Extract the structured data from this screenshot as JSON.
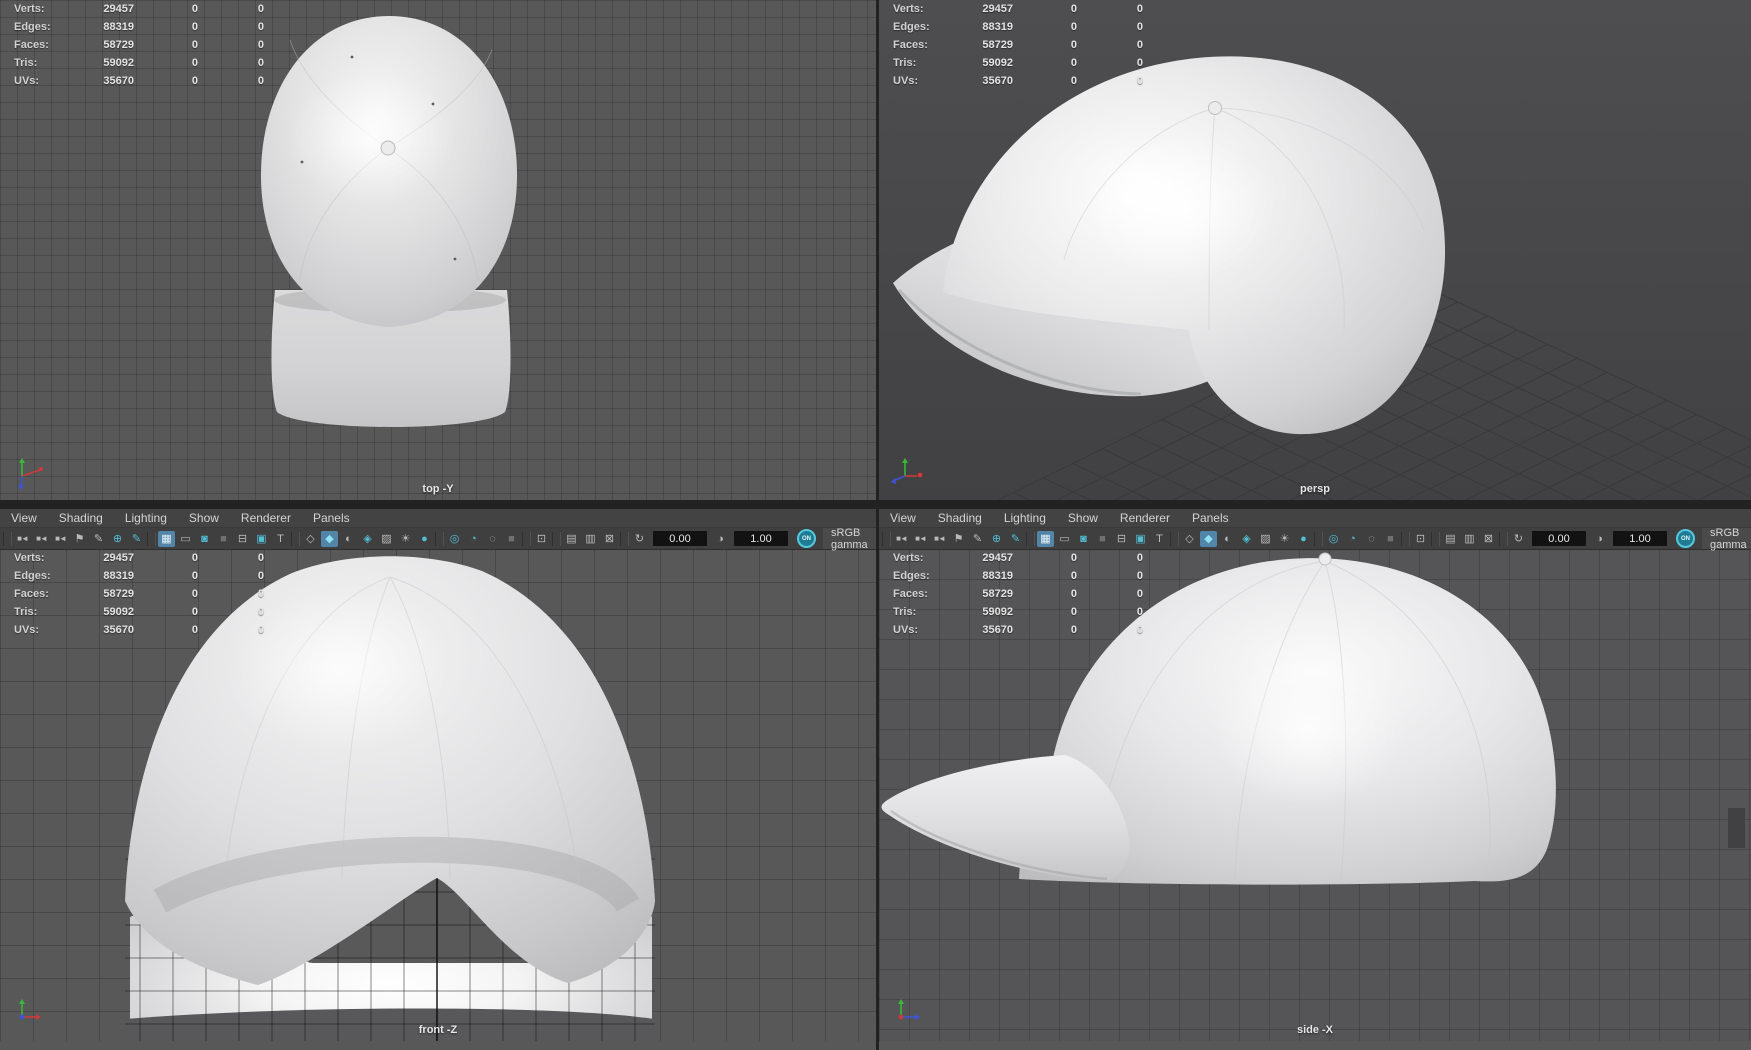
{
  "colors": {
    "viewport_bg": "#585858",
    "persp_bg_top": "#4e4e50",
    "persp_bg_bottom": "#414143",
    "chrome_bg": "#434343",
    "toolbar_bg": "#3f3f3f",
    "icon_gray": "#b9b9b9",
    "accent_teal": "#53bdd4",
    "icon_active_bg": "#5285a8",
    "field_bg": "#121212",
    "cap_base": "#d6d6d8",
    "axis_x": "#cc3333",
    "axis_y": "#33bb33",
    "axis_z": "#3355dd"
  },
  "stats": {
    "rows": [
      {
        "label": "Verts:",
        "value": "29457",
        "c2": "0",
        "c3": "0"
      },
      {
        "label": "Edges:",
        "value": "88319",
        "c2": "0",
        "c3": "0"
      },
      {
        "label": "Faces:",
        "value": "58729",
        "c2": "0",
        "c3": "0"
      },
      {
        "label": "Tris:",
        "value": "59092",
        "c2": "0",
        "c3": "0"
      },
      {
        "label": "UVs:",
        "value": "35670",
        "c2": "0",
        "c3": "0"
      }
    ]
  },
  "menu": {
    "items": [
      "View",
      "Shading",
      "Lighting",
      "Show",
      "Renderer",
      "Panels"
    ]
  },
  "toolbar": {
    "items": [
      {
        "type": "sep"
      },
      {
        "type": "icon",
        "name": "select-camera-icon",
        "glyph": "■◄",
        "cam": true
      },
      {
        "type": "icon",
        "name": "lock-camera-icon",
        "glyph": "■◄",
        "cam": true
      },
      {
        "type": "icon",
        "name": "camera-attributes-icon",
        "glyph": "■◄",
        "cam": true
      },
      {
        "type": "icon",
        "name": "bookmark-icon",
        "glyph": "⚑"
      },
      {
        "type": "icon",
        "name": "image-plane-icon",
        "glyph": "✎"
      },
      {
        "type": "icon",
        "name": "pan-zoom-icon",
        "glyph": "⊕",
        "tint": "teal"
      },
      {
        "type": "icon",
        "name": "greasepencil-icon",
        "glyph": "✎",
        "tint": "teal"
      },
      {
        "type": "sep"
      },
      {
        "type": "icon",
        "name": "grid-icon",
        "glyph": "▦",
        "active": true
      },
      {
        "type": "icon",
        "name": "film-gate-icon",
        "glyph": "▭"
      },
      {
        "type": "icon",
        "name": "resolution-gate-icon",
        "glyph": "◙",
        "tint": "teal"
      },
      {
        "type": "icon",
        "name": "gate-mask-icon",
        "glyph": "■",
        "dim": true
      },
      {
        "type": "icon",
        "name": "field-chart-icon",
        "glyph": "⊟"
      },
      {
        "type": "icon",
        "name": "safe-action-icon",
        "glyph": "▣",
        "tint": "teal"
      },
      {
        "type": "icon",
        "name": "safe-title-icon",
        "glyph": "T"
      },
      {
        "type": "sep"
      },
      {
        "type": "icon",
        "name": "wireframe-cube-icon",
        "glyph": "◇"
      },
      {
        "type": "icon",
        "name": "smooth-shade-icon",
        "glyph": "◆",
        "active": true,
        "tint": "teal"
      },
      {
        "type": "icon",
        "name": "wireframe-on-shaded-icon",
        "glyph": "◐"
      },
      {
        "type": "icon",
        "name": "textured-icon",
        "glyph": "◈",
        "tint": "teal"
      },
      {
        "type": "icon",
        "name": "use-default-material-icon",
        "glyph": "▨"
      },
      {
        "type": "icon",
        "name": "lights-icon",
        "glyph": "☀"
      },
      {
        "type": "icon",
        "name": "shadows-icon",
        "glyph": "●",
        "tint": "teal"
      },
      {
        "type": "sep"
      },
      {
        "type": "icon",
        "name": "occlusion-icon",
        "glyph": "◎",
        "tint": "teal"
      },
      {
        "type": "icon",
        "name": "motion-blur-icon",
        "glyph": "◔",
        "tint": "teal"
      },
      {
        "type": "icon",
        "name": "depth-of-field-icon",
        "glyph": "◌"
      },
      {
        "type": "icon",
        "name": "multisample-icon",
        "glyph": "■",
        "dim": true
      },
      {
        "type": "sep"
      },
      {
        "type": "icon",
        "name": "isolate-select-icon",
        "glyph": "⊡"
      },
      {
        "type": "sep"
      },
      {
        "type": "icon",
        "name": "snapshot-icon",
        "glyph": "▤"
      },
      {
        "type": "icon",
        "name": "scene-capture-icon",
        "glyph": "▥"
      },
      {
        "type": "icon",
        "name": "pane-toggle-icon",
        "glyph": "⊠"
      },
      {
        "type": "sep"
      },
      {
        "type": "field",
        "name": "exposure-field",
        "icon_name": "exposure-icon",
        "icon_glyph": "↻",
        "value": "0.00"
      },
      {
        "type": "field",
        "name": "gamma-field",
        "icon_name": "contrast-icon",
        "icon_glyph": "◑",
        "value": "1.00"
      },
      {
        "type": "on",
        "name": "color-management-toggle",
        "label": "ON"
      },
      {
        "type": "colorspace",
        "name": "colorspace-label",
        "text": "sRGB gamma"
      }
    ]
  },
  "panels": {
    "top_left": {
      "label": "top -Y"
    },
    "top_right": {
      "label": "persp"
    },
    "bottom_left": {
      "label": "front -Z"
    },
    "bottom_right": {
      "label": "side -X"
    }
  }
}
